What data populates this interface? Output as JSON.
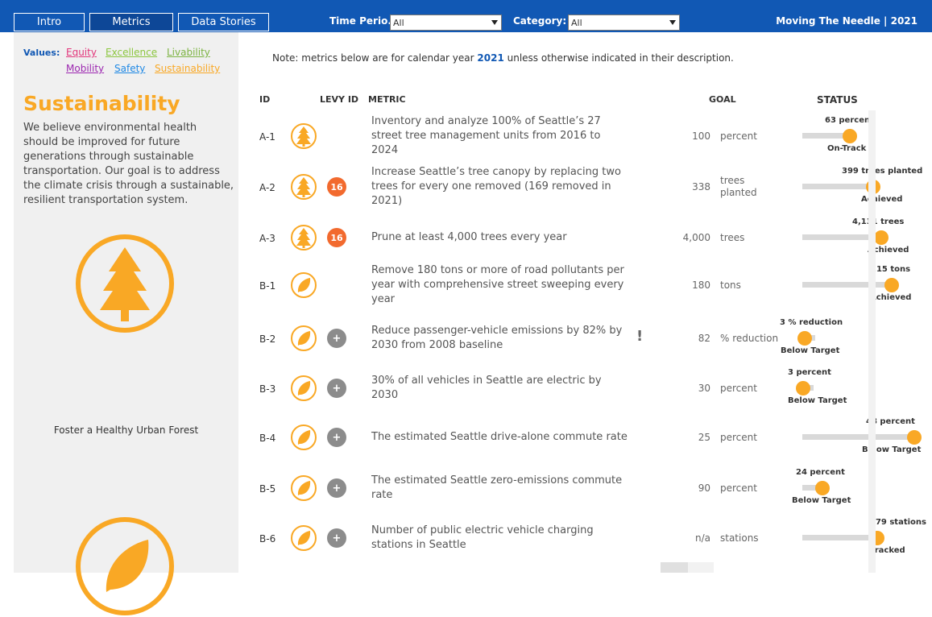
{
  "tabs": [
    "Intro",
    "Metrics",
    "Data Stories"
  ],
  "filters": {
    "time_period_label": "Time Perio...",
    "time_period_value": "All",
    "category_label": "Category:",
    "category_value": "All"
  },
  "brand": "Moving The Needle | 2021",
  "sidebar": {
    "values_label": "Values:",
    "values": [
      {
        "label": "Equity",
        "color": "#e2367b"
      },
      {
        "label": "Excellence",
        "color": "#8cc63f"
      },
      {
        "label": "Livability",
        "color": "#7cb342"
      },
      {
        "label": "Mobility",
        "color": "#9c27b0"
      },
      {
        "label": "Safety",
        "color": "#1e88e5"
      },
      {
        "label": "Sustainability",
        "color": "#f9a825"
      }
    ],
    "title": "Sustainability",
    "description": "We believe environmental health should be improved for future generations through sustainable transportation. Our goal is to address the climate crisis through a sustainable, resilient transportation system.",
    "caption": "Foster a Healthy Urban Forest",
    "accent": "#f9a825"
  },
  "note": {
    "prefix": "Note: metrics below are for calendar year ",
    "year": "2021",
    "suffix": " unless otherwise indicated in their description."
  },
  "headers": {
    "id": "ID",
    "levy": "LEVY ID",
    "metric": "METRIC",
    "goal": "GOAL",
    "status": "STATUS"
  },
  "rows": [
    {
      "id": "A-1",
      "icon": "tree-icon",
      "levy": "",
      "metric_lines": [
        "Inventory and analyze 100% of Seattle’s 27",
        "street tree management units from 2016 to",
        "2024"
      ],
      "goal": "100",
      "unit": "percent",
      "status_value": "63 percent",
      "status": "On-Track",
      "progress": 0.63
    },
    {
      "id": "A-2",
      "icon": "tree-icon",
      "levy": "16",
      "metric_lines": [
        "Increase Seattle’s tree canopy by replacing two",
        "trees for every one removed (169 removed in",
        "2021)"
      ],
      "goal": "338",
      "unit": "trees planted",
      "status_value": "399 trees planted",
      "status": "Achieved",
      "progress": 1.18
    },
    {
      "id": "A-3",
      "icon": "tree-icon",
      "levy": "16",
      "metric_lines": [
        "Prune at least 4,000 trees every year"
      ],
      "goal": "4,000",
      "unit": "trees",
      "status_value": "4,131 trees",
      "status": "Achieved",
      "progress": 1.03
    },
    {
      "id": "B-1",
      "icon": "leaf-icon",
      "levy": "",
      "metric_lines": [
        "Remove 180 tons or more of road pollutants per",
        "year with comprehensive street sweeping every",
        "year"
      ],
      "goal": "180",
      "unit": "tons",
      "status_value": "215 tons",
      "status": "Achieved",
      "progress": 1.19
    },
    {
      "id": "B-2",
      "icon": "leaf-icon",
      "levy": "+",
      "metric_lines": [
        "Reduce passenger-vehicle emissions by 82% by",
        "2030 from 2008 baseline"
      ],
      "goal": "82",
      "unit": "% reduction",
      "status_value": "3 % reduction",
      "status": "Below Target",
      "progress": 0.04
    },
    {
      "id": "B-3",
      "icon": "leaf-icon",
      "levy": "+",
      "metric_lines": [
        "30% of all vehicles in Seattle are electric by",
        "2030"
      ],
      "goal": "30",
      "unit": "percent",
      "status_value": "3 percent",
      "status": "Below Target",
      "progress": 0.1
    },
    {
      "id": "B-4",
      "icon": "leaf-icon",
      "levy": "+",
      "metric_lines": [
        "The estimated Seattle drive-alone commute rate"
      ],
      "goal": "25",
      "unit": "percent",
      "status_value": "48 percent",
      "status": "Below Target",
      "progress": 1.92
    },
    {
      "id": "B-5",
      "icon": "leaf-icon",
      "levy": "+",
      "metric_lines": [
        "The estimated Seattle zero-emissions commute",
        "rate"
      ],
      "goal": "90",
      "unit": "percent",
      "status_value": "24 percent",
      "status": "Below Target",
      "progress": 0.27
    },
    {
      "id": "B-6",
      "icon": "leaf-icon",
      "levy": "+",
      "metric_lines": [
        "Number of public electric vehicle charging",
        "stations in Seattle"
      ],
      "goal": "n/a",
      "unit": "stations",
      "status_value": "379 stations",
      "status": "Tracked",
      "progress": 1.0
    }
  ],
  "excl_mark": "!"
}
